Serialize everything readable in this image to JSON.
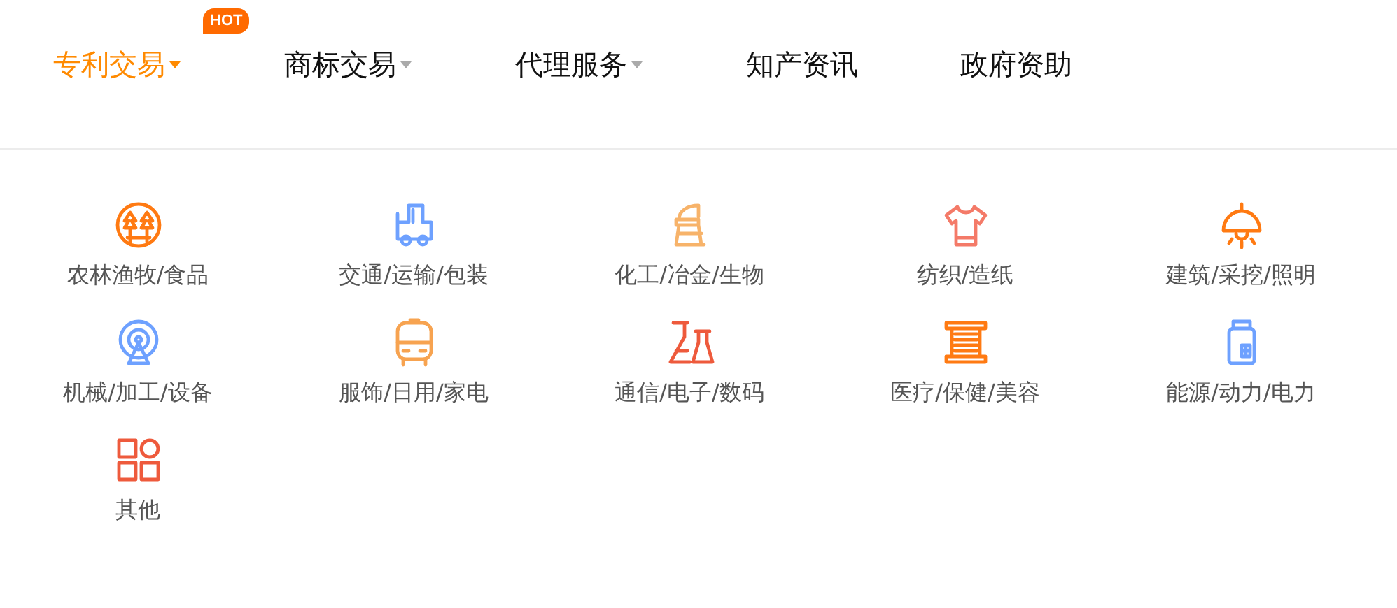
{
  "nav": {
    "items": [
      {
        "label": "专利交易",
        "selected": true,
        "dropdown": true,
        "badge": "HOT"
      },
      {
        "label": "商标交易",
        "selected": false,
        "dropdown": true
      },
      {
        "label": "代理服务",
        "selected": false,
        "dropdown": true
      },
      {
        "label": "知产资讯",
        "selected": false,
        "dropdown": false
      },
      {
        "label": "政府资助",
        "selected": false,
        "dropdown": false
      }
    ]
  },
  "categories": [
    {
      "label": "农林渔牧/食品"
    },
    {
      "label": "交通/运输/包装"
    },
    {
      "label": "化工/冶金/生物"
    },
    {
      "label": "纺织/造纸"
    },
    {
      "label": "建筑/采挖/照明"
    },
    {
      "label": "机械/加工/设备"
    },
    {
      "label": "服饰/日用/家电"
    },
    {
      "label": "通信/电子/数码"
    },
    {
      "label": "医疗/保健/美容"
    },
    {
      "label": "能源/动力/电力"
    },
    {
      "label": "其他"
    }
  ]
}
